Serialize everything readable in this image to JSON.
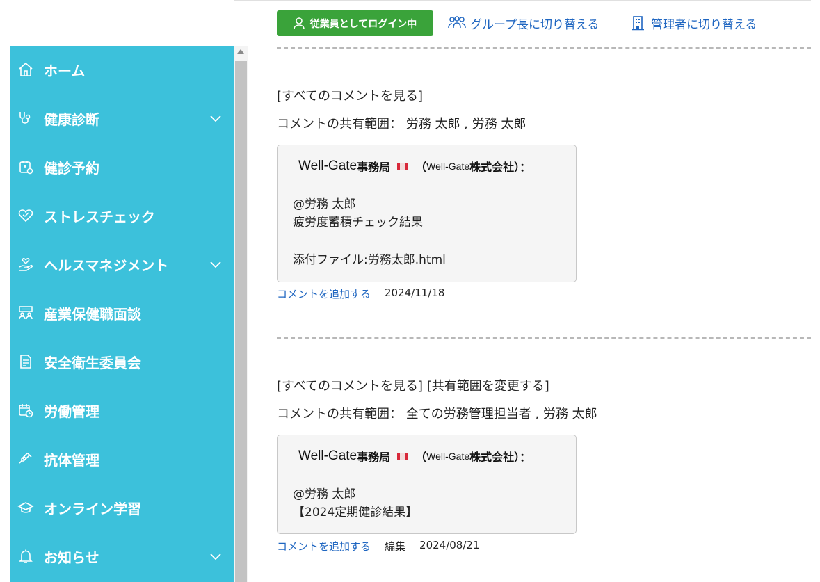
{
  "header": {
    "login_status": "従業員としてログイン中",
    "switch_group": "グループ長に切り替える",
    "switch_admin": "管理者に切り替える",
    "colors": {
      "login_bg": "#3aa33a",
      "link": "#1f66c1",
      "sidebar_bg": "#3cc1db"
    }
  },
  "sidebar": {
    "items": [
      {
        "label": "ホーム",
        "icon": "home-icon",
        "expandable": false
      },
      {
        "label": "健康診断",
        "icon": "stethoscope-icon",
        "expandable": true
      },
      {
        "label": "健診予約",
        "icon": "calendar-medical-icon",
        "expandable": false
      },
      {
        "label": "ストレスチェック",
        "icon": "heart-icon",
        "expandable": false
      },
      {
        "label": "ヘルスマネジメント",
        "icon": "hand-heart-icon",
        "expandable": true
      },
      {
        "label": "産業保健職面談",
        "icon": "interview-icon",
        "expandable": false
      },
      {
        "label": "安全衛生委員会",
        "icon": "document-icon",
        "expandable": false
      },
      {
        "label": "労働管理",
        "icon": "calendar-clock-icon",
        "expandable": false
      },
      {
        "label": "抗体管理",
        "icon": "syringe-icon",
        "expandable": false
      },
      {
        "label": "オンライン学習",
        "icon": "graduation-cap-icon",
        "expandable": false
      },
      {
        "label": "お知らせ",
        "icon": "bell-icon",
        "expandable": true
      }
    ]
  },
  "comments": [
    {
      "links": "[すべてのコメントを見る]",
      "share_scope": "コメントの共有範囲： 労務 太郎 , 労務 太郎",
      "author_name": "Well-Gate",
      "author_org": "事務局",
      "company_open": "（ ",
      "company_name": "Well-Gate",
      "company_suffix": "株式会社）：",
      "lines": [
        "@労務 太郎",
        "疲労度蓄積チェック結果",
        "",
        "添付ファイル:労務太郎.html"
      ],
      "add_comment": "コメントを追加する",
      "edit": "",
      "date": "2024/11/18"
    },
    {
      "links": "[すべてのコメントを見る]  [共有範囲を変更する]",
      "share_scope": "コメントの共有範囲： 全ての労務管理担当者 , 労務 太郎",
      "author_name": "Well-Gate",
      "author_org": "事務局",
      "company_open": "（ ",
      "company_name": "Well-Gate",
      "company_suffix": "株式会社）：",
      "lines": [
        "@労務 太郎",
        "【2024定期健診結果】"
      ],
      "add_comment": "コメントを追加する",
      "edit": "編集",
      "date": "2024/08/21"
    }
  ]
}
